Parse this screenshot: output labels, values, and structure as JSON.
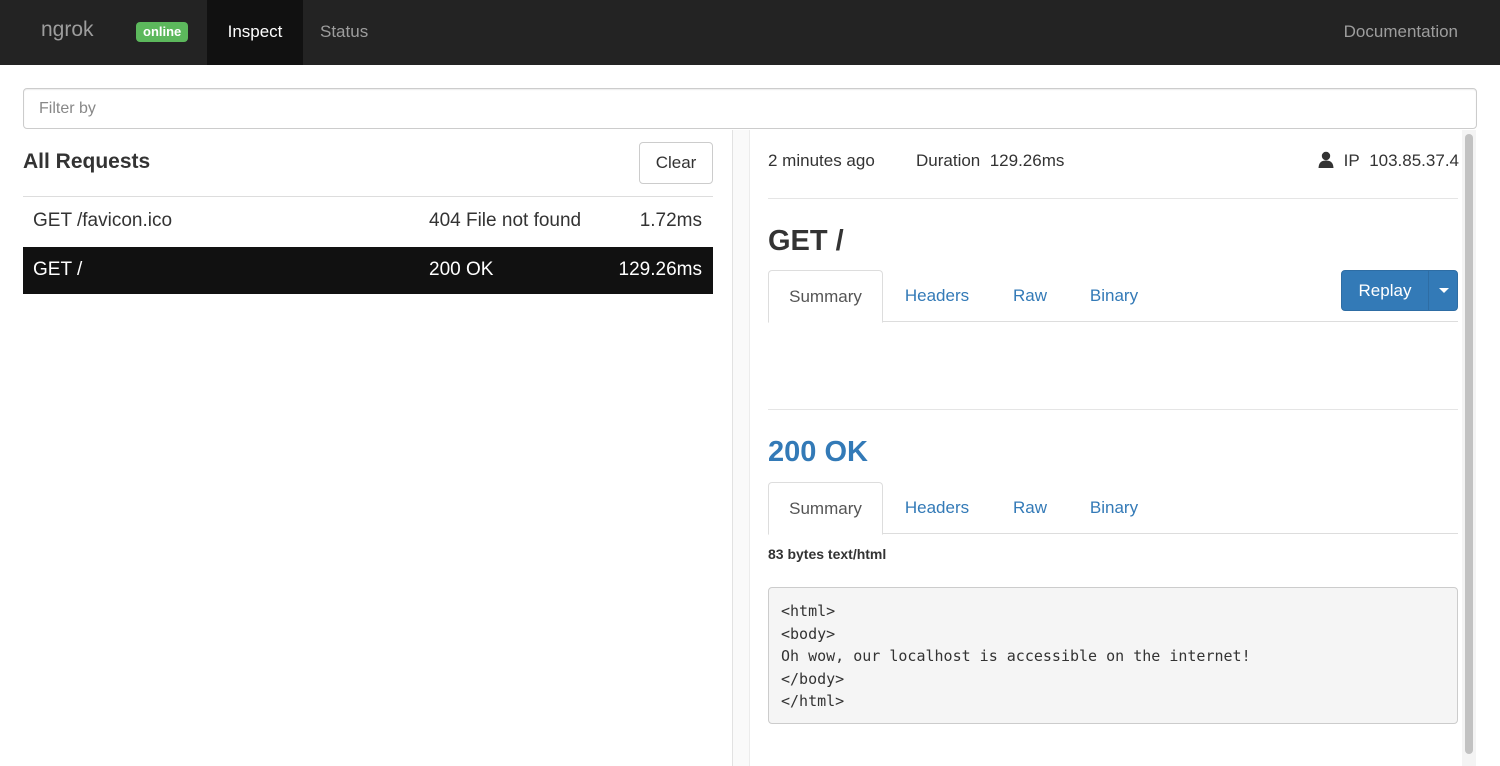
{
  "navbar": {
    "brand": "ngrok",
    "status_badge": "online",
    "items": [
      {
        "label": "Inspect",
        "active": true
      },
      {
        "label": "Status",
        "active": false
      }
    ],
    "documentation": "Documentation"
  },
  "filter": {
    "placeholder": "Filter by",
    "value": ""
  },
  "requests": {
    "title": "All Requests",
    "clear_label": "Clear",
    "rows": [
      {
        "path": "GET /favicon.ico",
        "status": "404 File not found",
        "duration": "1.72ms",
        "selected": false
      },
      {
        "path": "GET /",
        "status": "200 OK",
        "duration": "129.26ms",
        "selected": true
      }
    ]
  },
  "detail": {
    "time_ago": "2 minutes ago",
    "duration_label": "Duration",
    "duration_value": "129.26ms",
    "ip_label": "IP",
    "ip_value": "103.85.37.4",
    "request_title": "GET /",
    "request_tabs": [
      "Summary",
      "Headers",
      "Raw",
      "Binary"
    ],
    "replay_label": "Replay",
    "response_title": "200 OK",
    "response_tabs": [
      "Summary",
      "Headers",
      "Raw",
      "Binary"
    ],
    "body_size": "83 bytes text/html",
    "body_lines": [
      "<html>",
      "<body>",
      "Oh wow, our localhost is accessible on the internet!",
      "</body>",
      "</html>"
    ]
  },
  "colors": {
    "navbar_bg": "#232323",
    "badge_green": "#5cb85c",
    "link_blue": "#337ab7",
    "selected_row_bg": "#111111"
  },
  "icons": {
    "user": "user-icon",
    "replay_caret": "caret-down-icon"
  }
}
